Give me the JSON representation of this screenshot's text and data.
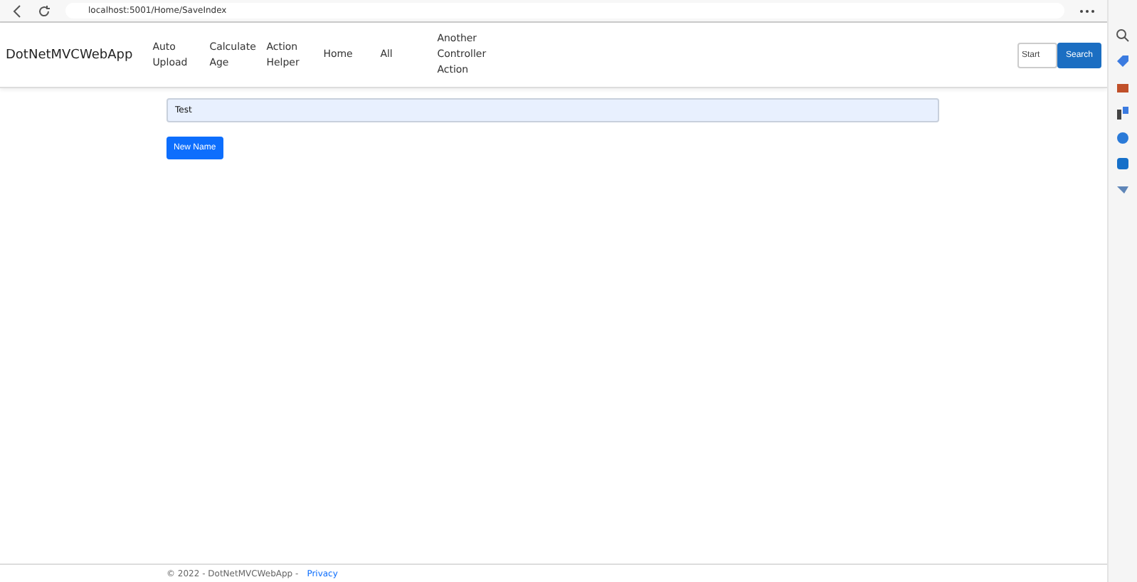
{
  "browser": {
    "url": "localhost:5001/Home/SaveIndex"
  },
  "navbar": {
    "brand": "DotNetMVCWebApp",
    "links": [
      {
        "label": "Auto Upload"
      },
      {
        "label": "Calculate Age"
      },
      {
        "label": "Action Helper"
      },
      {
        "label": "Home"
      },
      {
        "label": "All"
      },
      {
        "label": "Another Controller Action"
      }
    ],
    "search": {
      "placeholder": "Start"
    },
    "search_button": "Search"
  },
  "name_field": {
    "value": "Test"
  },
  "new_name_button": "New Name",
  "footer": {
    "text": "© 2022 - DotNetMVCWebApp -",
    "link": "Privacy"
  }
}
